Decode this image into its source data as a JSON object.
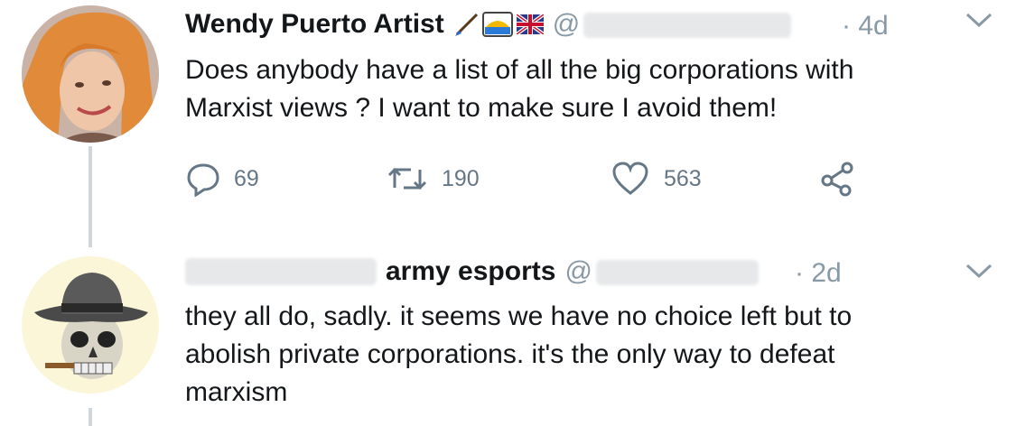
{
  "tweets": [
    {
      "author_name": "Wendy Puerto Artist",
      "handle_prefix": "@",
      "time": "4d",
      "text_lines": [
        "Does anybody have a list of all the big corporations with",
        "Marxist views ? I want to make sure I avoid them!"
      ],
      "reply_count": "69",
      "retweet_count": "190",
      "like_count": "563"
    },
    {
      "author_name": "army esports",
      "handle_prefix": "@",
      "time": "2d",
      "text_lines": [
        "they all do, sadly. it seems we have no choice left but to",
        "abolish private corporations. it's the only way to defeat",
        "marxism"
      ]
    }
  ],
  "icons": {
    "reply": "speech-bubble-icon",
    "retweet": "retweet-icon",
    "like": "heart-icon",
    "share": "share-icon",
    "menu": "chevron-down-icon"
  },
  "colors": {
    "text": "#14171a",
    "secondary": "#8899a6",
    "action": "#657786",
    "thread_line": "#cfd6dc"
  }
}
